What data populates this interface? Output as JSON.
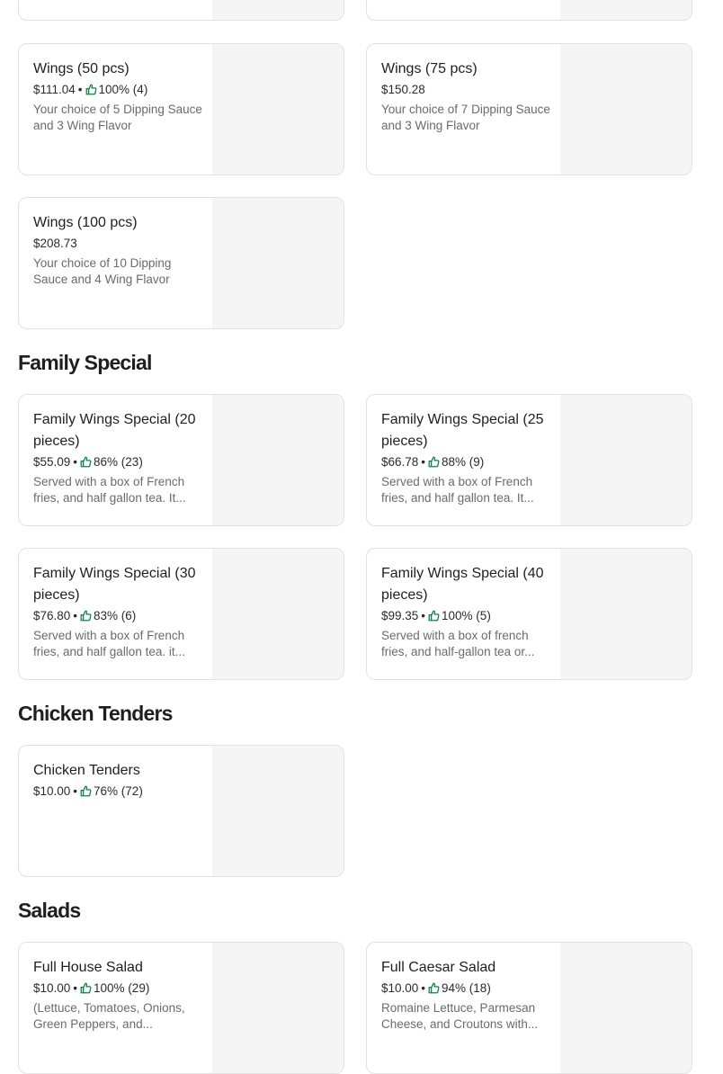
{
  "sections": {
    "wings": {
      "items": [
        {
          "name": "Wings (50 pcs)",
          "price": "$111.04",
          "rating": "100% (4)",
          "desc": "Your choice of 5 Dipping Sauce and 3 Wing Flavor"
        },
        {
          "name": "Wings (75 pcs)",
          "price": "$150.28",
          "desc": "Your choice of 7 Dipping Sauce and 3 Wing Flavor"
        },
        {
          "name": "Wings (100 pcs)",
          "price": "$208.73",
          "desc": "Your choice of 10 Dipping Sauce and 4 Wing Flavor"
        }
      ]
    },
    "family": {
      "title": "Family Special",
      "items": [
        {
          "name": "Family Wings Special (20 pieces)",
          "price": "$55.09",
          "rating": "86% (23)",
          "desc": "Served with a box of French fries, and half gallon tea. It..."
        },
        {
          "name": "Family Wings Special (25 pieces)",
          "price": "$66.78",
          "rating": "88% (9)",
          "desc": "Served with a box of French fries, and half gallon tea. It..."
        },
        {
          "name": "Family Wings Special (30 pieces)",
          "price": "$76.80",
          "rating": "83% (6)",
          "desc": "Served with a box of French fries, and half gallon tea. it..."
        },
        {
          "name": "Family Wings Special (40 pieces)",
          "price": "$99.35",
          "rating": "100% (5)",
          "desc": "Served with a box of french fries, and half-gallon tea or..."
        }
      ]
    },
    "tenders": {
      "title": "Chicken Tenders",
      "items": [
        {
          "name": "Chicken Tenders",
          "price": "$10.00",
          "rating": "76% (72)"
        }
      ]
    },
    "salads": {
      "title": "Salads",
      "items": [
        {
          "name": "Full House Salad",
          "price": "$10.00",
          "rating": "100% (29)",
          "desc": "(Lettuce, Tomatoes, Onions, Green Peppers, and..."
        },
        {
          "name": "Full Caesar Salad",
          "price": "$10.00",
          "rating": "94% (18)",
          "desc": "Romaine Lettuce, Parmesan Cheese, and Croutons with..."
        }
      ]
    }
  },
  "separator": "•",
  "icons": {
    "rating": "thumbs-up-icon",
    "thumb_color": "#0e8345"
  }
}
